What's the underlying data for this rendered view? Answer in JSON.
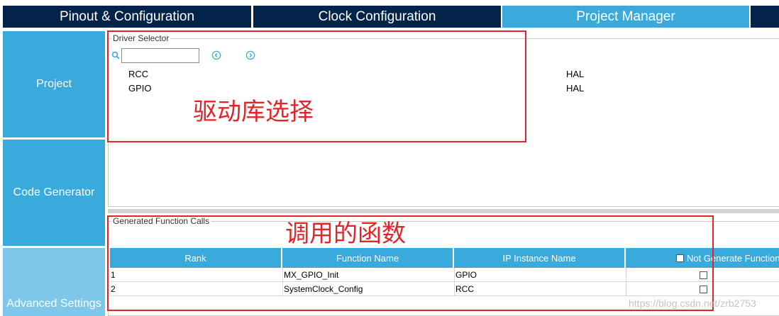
{
  "tabs": [
    {
      "label": "Pinout & Configuration",
      "active": false
    },
    {
      "label": "Clock Configuration",
      "active": false
    },
    {
      "label": "Project Manager",
      "active": true
    }
  ],
  "sidebar": {
    "items": [
      {
        "label": "Project"
      },
      {
        "label": "Code Generator"
      },
      {
        "label": "Advanced Settings"
      }
    ]
  },
  "driver_selector": {
    "legend": "Driver Selector",
    "search_value": "",
    "search_icon": "search-icon",
    "prev_icon": "chevron-left-circle-icon",
    "next_icon": "chevron-right-circle-icon",
    "rows": [
      {
        "name": "RCC",
        "value": "HAL"
      },
      {
        "name": "GPIO",
        "value": "HAL"
      }
    ]
  },
  "generated_calls": {
    "legend": "Generated Function Calls",
    "columns": [
      "Rank",
      "Function Name",
      "IP Instance Name",
      "Not Generate Function Call"
    ],
    "rows": [
      {
        "rank": "1",
        "function": "MX_GPIO_Init",
        "instance": "GPIO",
        "not_generate": false
      },
      {
        "rank": "2",
        "function": "SystemClock_Config",
        "instance": "RCC",
        "not_generate": false
      }
    ]
  },
  "annotations": {
    "driver_note": "驱动库选择",
    "calls_note": "调用的函数"
  },
  "watermark": "https://blog.csdn.net/zrb2753",
  "colors": {
    "tab_dark": "#03234b",
    "accent_blue": "#3aa9dc",
    "annotation_red": "#e0262a"
  }
}
